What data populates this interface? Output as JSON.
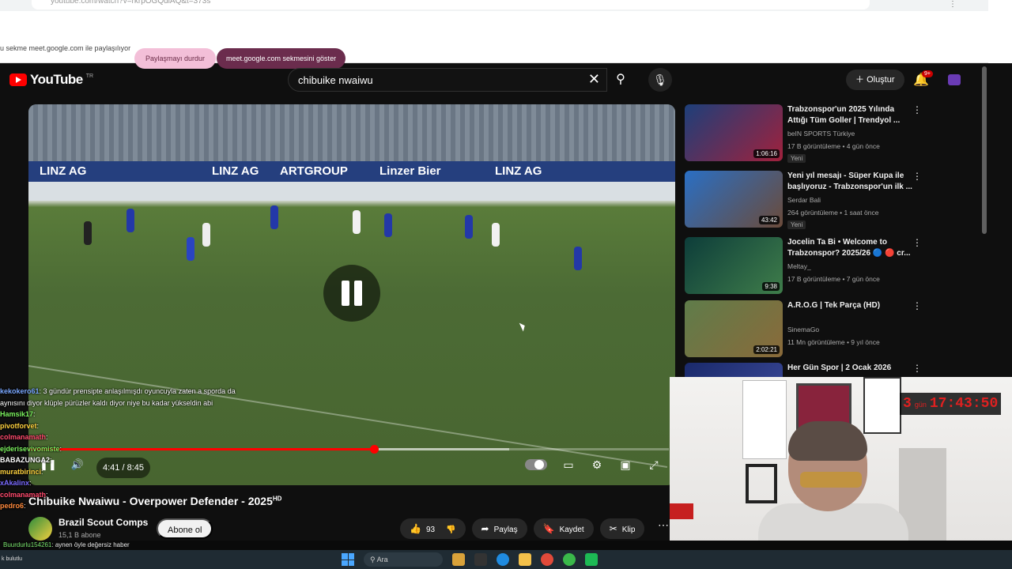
{
  "browser": {
    "url": "youtube.com/watch?v=rkrpOGQdlAQ&t=373s",
    "share_text": "u sekme meet.google.com ile paylaşılıyor",
    "stop_share_label": "Paylaşmayı durdur",
    "show_tab_label": "meet.google.com sekmesini göster"
  },
  "youtube": {
    "logo_text": "YouTube",
    "country": "TR",
    "search_value": "chibuike nwaiwu",
    "create_label": "Oluştur",
    "notif_badge": "9+"
  },
  "player": {
    "time": "4:41 / 8:45",
    "progress": 0.54,
    "buffered": 0.75,
    "title": "Chibuike Nwaiwu - Overpower Defender - 2025",
    "title_hd": "HD",
    "channel": "Brazil Scout Comps",
    "subs": "15,1 B abone",
    "subscribe_label": "Abone ol",
    "likes": "93",
    "share_label": "Paylaş",
    "save_label": "Kaydet",
    "clip_label": "Klip",
    "board_words": [
      "LINZ AG",
      "LINZ AG",
      "ARTGROUP",
      "Linzer Bier",
      "LINZ AG"
    ]
  },
  "chat": [
    {
      "user": "kekokero61",
      "msg": ": 3 gündür prensipte anlaşılmışdı oyuncuyla zaten a sporda da",
      "color": "#7aa7ff"
    },
    {
      "user": "",
      "msg": "aynısını diyor klüple pürüzler kaldı diyor niye bu kadar yükseldin abi",
      "color": "#ffffff"
    },
    {
      "user": "Hamsik17",
      "msg": ":",
      "color": "#7cf35f"
    },
    {
      "user": "pivotforvet",
      "msg": ":",
      "color": "#ffd23f"
    },
    {
      "user": "colmanamath",
      "msg": ":",
      "color": "#ff4a6d"
    },
    {
      "user": "ejderisevivomiste",
      "msg": ":",
      "color": "#7cf35f"
    },
    {
      "user": "BABAZUNGA2",
      "msg": ":",
      "color": "#ffffff"
    },
    {
      "user": "muratbirinci",
      "msg": ":",
      "color": "#ffd23f"
    },
    {
      "user": "xAkalinx",
      "msg": ":",
      "color": "#7a6bff"
    },
    {
      "user": "colmanamath",
      "msg": ":",
      "color": "#ff4a6d"
    },
    {
      "user": "pedro6",
      "msg": ":",
      "color": "#ff8a3d"
    }
  ],
  "ticker": {
    "user": "Buurdurlu154261",
    "msg": ": aynen öyle değersiz haber"
  },
  "recommendations": [
    {
      "title": "Trabzonspor'un 2025 Yılında Attığı Tüm Goller | Trendyol ...",
      "channel": "beIN SPORTS Türkiye",
      "meta": "17 B görüntüleme • 4 gün önce",
      "badge": "Yeni",
      "duration": "1:06:16",
      "color1": "#1d3f7a",
      "color2": "#a0213c"
    },
    {
      "title": "Yeni yıl mesajı - Süper Kupa ile başlıyoruz - Trabzonspor'un ilk ...",
      "channel": "Serdar Bali",
      "meta": "264 görüntüleme • 1 saat önce",
      "badge": "Yeni",
      "duration": "43:42",
      "color1": "#2a6fc4",
      "color2": "#6b4b3a"
    },
    {
      "title": "Jocelin Ta Bi • Welcome to Trabzonspor? 2025/26 🔵 🔴 cr...",
      "channel": "Meltay_",
      "meta": "17 B görüntüleme • 7 gün önce",
      "badge": "",
      "duration": "9:38",
      "color1": "#0d3d3a",
      "color2": "#3f7d4a"
    },
    {
      "title": "A.R.O.G | Tek Parça (HD)",
      "channel": "SinemaGo",
      "meta": "11 Mn görüntüleme • 9 yıl önce",
      "badge": "",
      "duration": "2:02:21",
      "color1": "#5f7c4a",
      "color2": "#8a6a3a"
    },
    {
      "title": "Her Gün Spor | 2 Ocak 2026",
      "channel": "",
      "meta": "",
      "badge": "",
      "duration": "",
      "color1": "#1a2a6b",
      "color2": "#3d4a9a"
    }
  ],
  "webcam": {
    "timer_days": "3",
    "timer_day_label": "gün",
    "timer": "17:43:50"
  },
  "taskbar": {
    "search_placeholder": "Ara",
    "left_text": "k bulutlu"
  }
}
